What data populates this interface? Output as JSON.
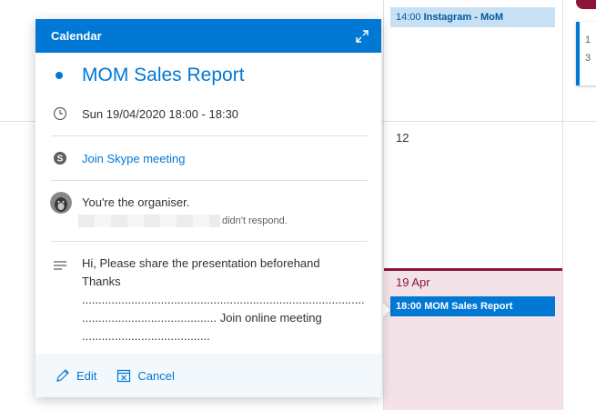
{
  "calendar_bg": {
    "day_numbers": {
      "d12": "12",
      "today": "19 Apr"
    },
    "events": {
      "instagram": {
        "time": "14:00",
        "title": "Instagram - MoM"
      },
      "mom": {
        "time": "18:00",
        "title": "MOM Sales Report"
      }
    },
    "right_edge_event": {
      "line1": "1",
      "line2": "3"
    },
    "colors": {
      "today_accent": "#8a1538",
      "event_blue": "#0078d4",
      "event_light": "#c7e0f4"
    }
  },
  "popup": {
    "header_title": "Calendar",
    "expand_icon": "expand-icon",
    "event_title": "MOM Sales Report",
    "datetime": "Sun 19/04/2020 18:00 - 18:30",
    "skype_link": "Join Skype meeting",
    "organiser_text": "You're the organiser.",
    "didnt_respond": "didn't respond.",
    "notes": {
      "line1": "Hi, Please share the presentation beforehand",
      "line2": "Thanks",
      "line3": "..............................................................................................",
      "line4": "......................................... Join online meeting",
      "line5": "......................................."
    },
    "footer": {
      "edit_label": "Edit",
      "cancel_label": "Cancel"
    },
    "colors": {
      "accent": "#0078d4",
      "footer_bg": "#f3f8fc"
    }
  }
}
